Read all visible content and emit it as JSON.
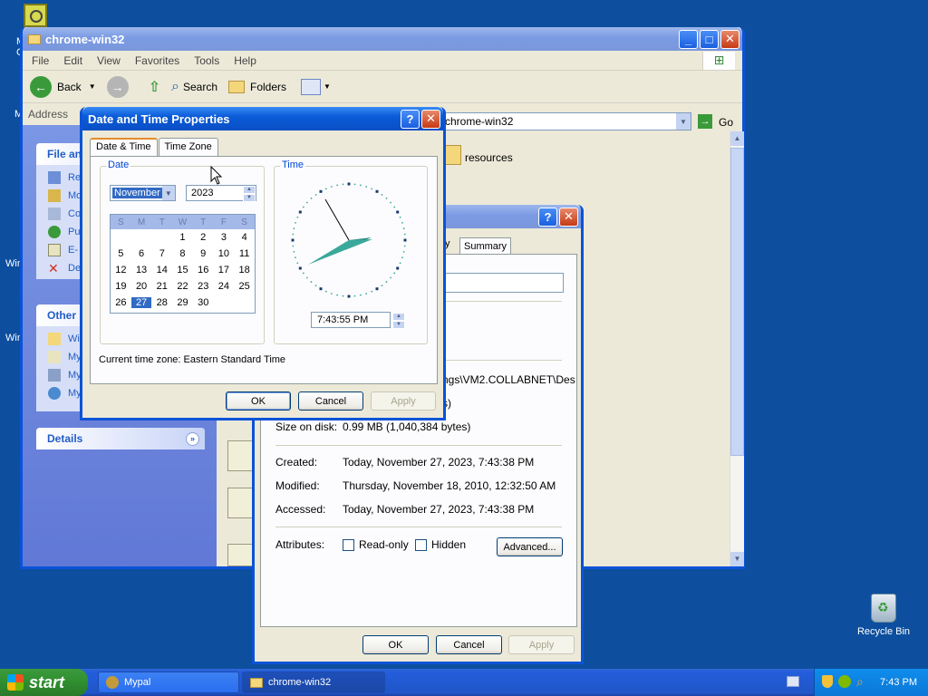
{
  "desktop": {
    "recycle_bin_label": "Recycle Bin",
    "fragments": [
      "M",
      "C",
      "M",
      "Win",
      "Win"
    ]
  },
  "explorer": {
    "title": "chrome-win32",
    "menu": [
      "File",
      "Edit",
      "View",
      "Favorites",
      "Tools",
      "Help"
    ],
    "toolbar": {
      "back": "Back",
      "search": "Search",
      "folders": "Folders"
    },
    "address_label": "Address",
    "address_value": "chrome-win32",
    "go_label": "Go",
    "file_item": "resources",
    "taskpane": {
      "file_tasks_title": "File an",
      "file_tasks": [
        "Re",
        "Mo",
        "Co",
        "Pu",
        "E-",
        "De"
      ],
      "other_places_title": "Other P",
      "other_places": [
        "Wi",
        "My",
        "My",
        "My"
      ],
      "details_title": "Details"
    }
  },
  "properties": {
    "tab_partial": "y",
    "tab_summary": "Summary",
    "location_fragment": "ngs\\VM2.COLLABNET\\Des",
    "size_fragment": "s)",
    "size_on_disk_label": "Size on disk:",
    "size_on_disk_value": "0.99 MB (1,040,384 bytes)",
    "created_label": "Created:",
    "created_value": "Today, November 27, 2023, 7:43:38 PM",
    "modified_label": "Modified:",
    "modified_value": "Thursday, November 18, 2010, 12:32:50 AM",
    "accessed_label": "Accessed:",
    "accessed_value": "Today, November 27, 2023, 7:43:38 PM",
    "attributes_label": "Attributes:",
    "readonly_label": "Read-only",
    "hidden_label": "Hidden",
    "advanced_label": "Advanced...",
    "ok": "OK",
    "cancel": "Cancel",
    "apply": "Apply"
  },
  "datetime": {
    "title": "Date and Time Properties",
    "tab_date_time": "Date & Time",
    "tab_time_zone": "Time Zone",
    "date_group": "Date",
    "time_group": "Time",
    "month": "November",
    "year": "2023",
    "weekdays": [
      "S",
      "M",
      "T",
      "W",
      "T",
      "F",
      "S"
    ],
    "days": [
      "",
      "",
      "",
      "1",
      "2",
      "3",
      "4",
      "5",
      "6",
      "7",
      "8",
      "9",
      "10",
      "11",
      "12",
      "13",
      "14",
      "15",
      "16",
      "17",
      "18",
      "19",
      "20",
      "21",
      "22",
      "23",
      "24",
      "25",
      "26",
      "27",
      "28",
      "29",
      "30",
      "",
      ""
    ],
    "selected_day": "27",
    "time": "7:43:55 PM",
    "timezone_text": "Current time zone:  Eastern Standard Time",
    "ok": "OK",
    "cancel": "Cancel",
    "apply": "Apply"
  },
  "taskbar": {
    "start": "start",
    "buttons": [
      "Mypal",
      "chrome-win32"
    ],
    "clock": "7:43 PM"
  },
  "colors": {
    "desktop": "#0d4f9e",
    "title_active": "#0a53d7",
    "selection": "#316ac5"
  }
}
